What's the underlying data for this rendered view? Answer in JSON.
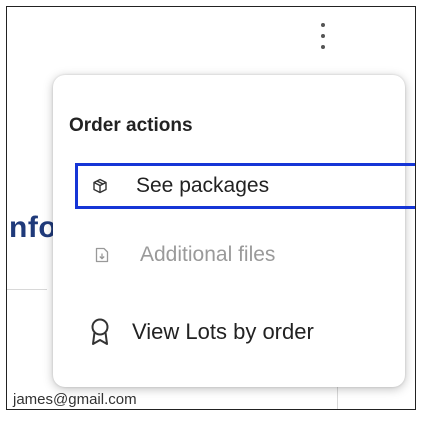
{
  "background": {
    "heading_fragment": "nfo",
    "email": "james@gmail.com"
  },
  "menu": {
    "title": "Order actions",
    "items": [
      {
        "label": "See packages",
        "icon": "package-icon",
        "state": "focused"
      },
      {
        "label": "Additional files",
        "icon": "file-download-icon",
        "state": "disabled"
      },
      {
        "label": "View Lots by order",
        "icon": "award-ribbon-icon",
        "state": "enabled"
      }
    ]
  },
  "colors": {
    "focus_outline": "#1535d6",
    "heading": "#1f3a7a",
    "disabled_text": "#9a9a9a"
  }
}
